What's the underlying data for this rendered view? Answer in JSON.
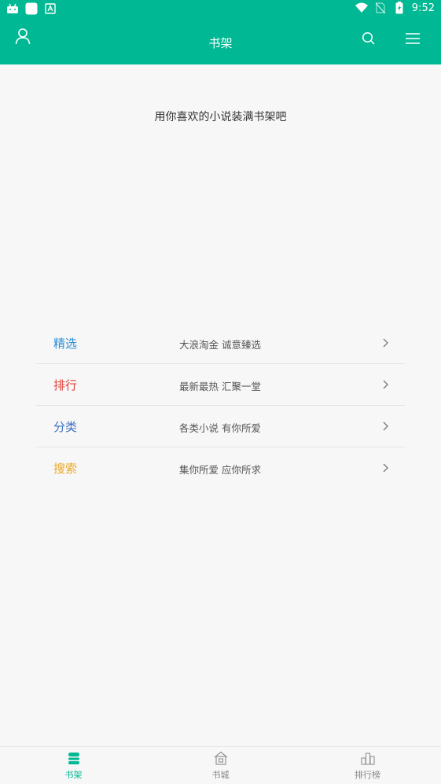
{
  "status_bar": {
    "time": "9:52"
  },
  "app_bar": {
    "title": "书架"
  },
  "shelf": {
    "empty_message": "用你喜欢的小说装满书架吧"
  },
  "entries": [
    {
      "title": "精选",
      "desc": "大浪淘金  诚意臻选",
      "color": "#2a8fd6"
    },
    {
      "title": "排行",
      "desc": "最新最热  汇聚一堂",
      "color": "#e0413b"
    },
    {
      "title": "分类",
      "desc": "各类小说  有你所爱",
      "color": "#3d6fc4"
    },
    {
      "title": "搜索",
      "desc": "集你所爱  应你所求",
      "color": "#eaa825"
    }
  ],
  "bottom_nav": [
    {
      "label": "书架",
      "icon": "bookshelf-icon",
      "active": true
    },
    {
      "label": "书城",
      "icon": "bookstore-icon",
      "active": false
    },
    {
      "label": "排行榜",
      "icon": "ranking-icon",
      "active": false
    }
  ],
  "colors": {
    "primary": "#00b893",
    "background": "#f7f7f7"
  }
}
